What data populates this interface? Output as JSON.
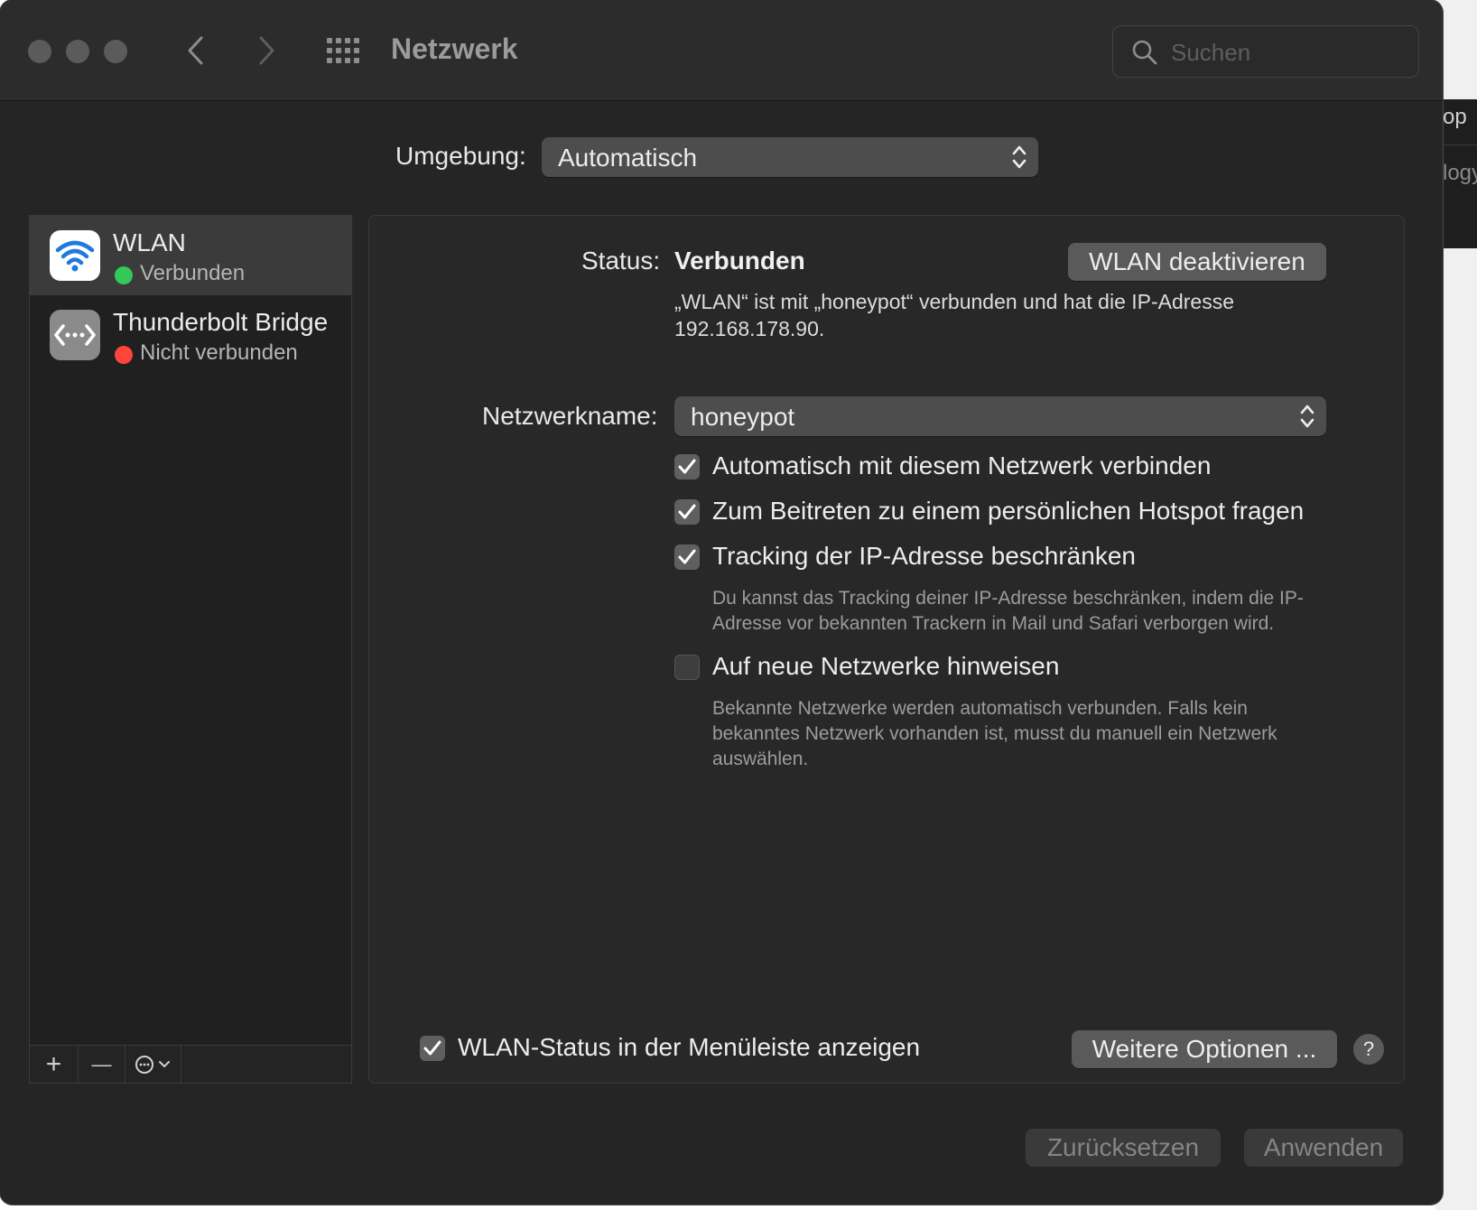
{
  "window": {
    "title": "Netzwerk",
    "search_placeholder": "Suchen"
  },
  "background_app": {
    "text1": "op",
    "text2": "logy"
  },
  "umgebung": {
    "label": "Umgebung:",
    "value": "Automatisch"
  },
  "services": [
    {
      "name": "WLAN",
      "status": "Verbunden",
      "status_color": "#34c759",
      "icon": "wifi-icon"
    },
    {
      "name": "Thunderbolt Bridge",
      "status": "Nicht verbunden",
      "status_color": "#ff453a",
      "icon": "thunderbolt-bridge-icon"
    }
  ],
  "sidebar_toolbar": {
    "add": "+",
    "remove": "—"
  },
  "detail": {
    "status_label": "Status:",
    "status_value": "Verbunden",
    "toggle_button": "WLAN deaktivieren",
    "status_desc_line1": "„WLAN“ ist mit „honeypot“ verbunden und hat die IP-Adresse",
    "status_desc_line2": "192.168.178.90.",
    "network_name_label": "Netzwerkname:",
    "network_name_value": "honeypot",
    "checkboxes": [
      {
        "label": "Automatisch mit diesem Netzwerk verbinden",
        "checked": true
      },
      {
        "label": "Zum Beitreten zu einem persönlichen Hotspot fragen",
        "checked": true
      },
      {
        "label": "Tracking der IP-Adresse beschränken",
        "checked": true
      },
      {
        "label": "Auf neue Netzwerke hinweisen",
        "checked": false
      }
    ],
    "tracking_hint_line1": "Du kannst das Tracking deiner IP-Adresse beschränken, indem die IP-",
    "tracking_hint_line2": "Adresse vor bekannten Trackern in Mail und Safari verborgen wird.",
    "new_networks_hint_line1": "Bekannte Netzwerke werden automatisch verbunden. Falls kein",
    "new_networks_hint_line2": "bekanntes Netzwerk vorhanden ist, musst du manuell ein Netzwerk",
    "new_networks_hint_line3": "auswählen.",
    "menubar_checkbox": {
      "label": "WLAN-Status in der Menüleiste anzeigen",
      "checked": true
    },
    "more_options_button": "Weitere Optionen ...",
    "help": "?"
  },
  "footer": {
    "reset_button": "Zurücksetzen",
    "apply_button": "Anwenden"
  }
}
